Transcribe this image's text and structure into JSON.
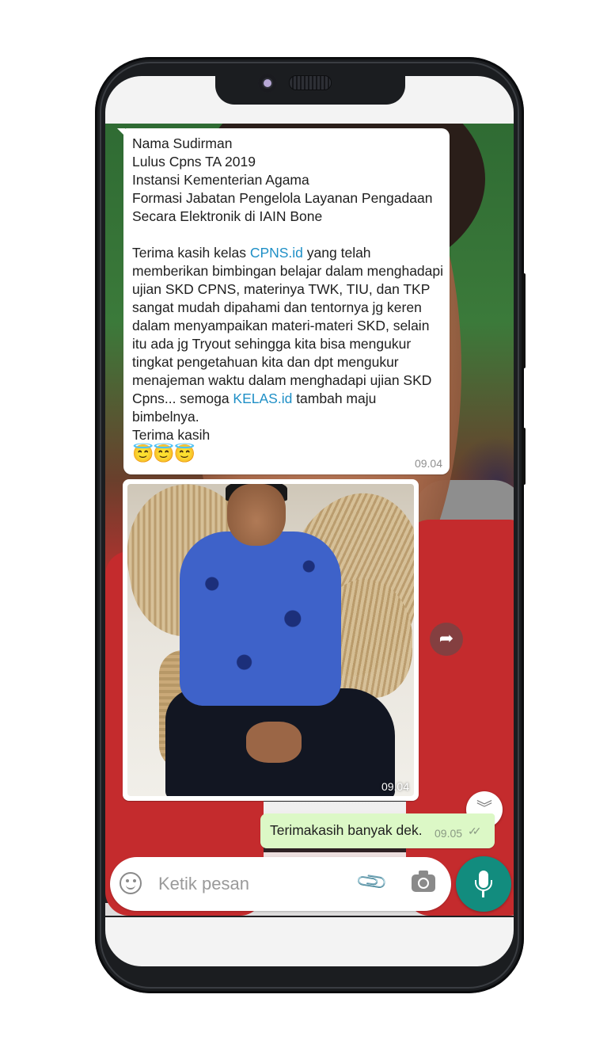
{
  "incoming_message": {
    "lines_block1": [
      "Nama Sudirman",
      "Lulus Cpns TA 2019",
      "Instansi Kementerian Agama",
      "Formasi Jabatan Pengelola Layanan Pengadaan",
      "Secara Elektronik di IAIN Bone"
    ],
    "para_start": "Terima kasih kelas ",
    "link1": "CPNS.id",
    "para_mid": " yang telah memberikan bimbingan belajar dalam menghadapi ujian SKD CPNS, materinya TWK, TIU, dan TKP sangat mudah dipahami dan tentornya jg keren dalam menyampaikan materi-materi SKD, selain itu ada jg Tryout sehingga kita bisa mengukur tingkat pengetahuan kita dan dpt mengukur menajeman waktu dalam menghadapi ujian SKD Cpns... semoga ",
    "link2": "KELAS.id",
    "para_end": " tambah maju bimbelnya.",
    "closing": "Terima kasih",
    "emojis": "😇😇😇",
    "time": "09.04"
  },
  "image_message": {
    "time": "09.04"
  },
  "outgoing_message": {
    "text": "Terimakasih banyak dek.",
    "time": "09.05",
    "ticks": "✓✓"
  },
  "composer": {
    "placeholder": "Ketik pesan"
  },
  "icons": {
    "share": "share-icon",
    "scroll_down": "chevron-double-down-icon",
    "emoji": "emoji-icon",
    "attach": "paperclip-icon",
    "camera": "camera-icon",
    "mic": "mic-icon"
  },
  "colors": {
    "accent": "#128c7e",
    "outgoing_bubble": "#dcf8c6",
    "link": "#1e8fc6"
  }
}
